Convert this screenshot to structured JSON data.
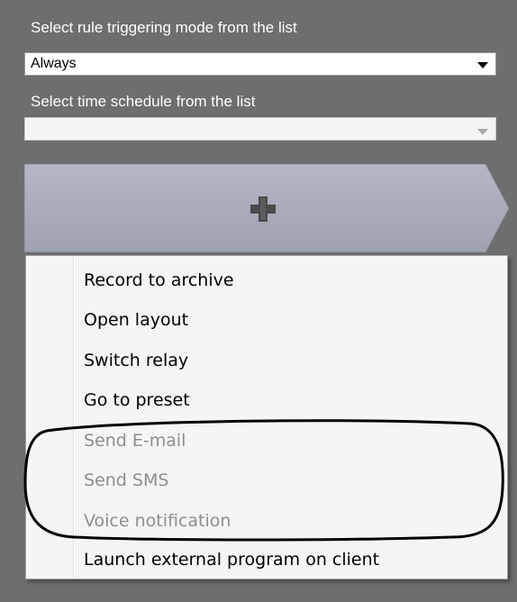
{
  "trigger_mode": {
    "label": "Select rule triggering mode from the list",
    "value": "Always"
  },
  "schedule": {
    "label": "Select time schedule from the list",
    "value": ""
  },
  "add_button": {
    "icon": "plus-icon"
  },
  "context_menu": {
    "items": [
      {
        "label": "Record to archive",
        "enabled": true
      },
      {
        "label": "Open layout",
        "enabled": true
      },
      {
        "label": "Switch relay",
        "enabled": true
      },
      {
        "label": "Go to preset",
        "enabled": true
      },
      {
        "label": "Send E-mail",
        "enabled": false
      },
      {
        "label": "Send SMS",
        "enabled": false
      },
      {
        "label": "Voice notification",
        "enabled": false
      },
      {
        "label": "Launch external program on client",
        "enabled": true
      }
    ]
  },
  "colors": {
    "panel_bg": "#6e6e6e",
    "menu_bg": "#f5f5f5",
    "disabled_text": "#8d8d8d",
    "button_fill": "#a6a9b8"
  }
}
